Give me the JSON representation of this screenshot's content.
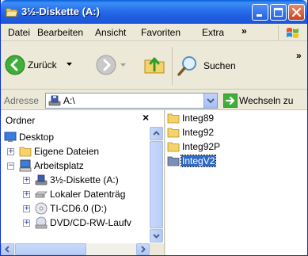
{
  "window": {
    "title": "3½-Diskette (A:)",
    "controls": [
      "minimize",
      "maximize",
      "close"
    ]
  },
  "menubar": {
    "items": [
      "Datei",
      "Bearbeiten",
      "Ansicht",
      "Favoriten",
      "Extra"
    ],
    "overflow": "»"
  },
  "toolbar": {
    "back_label": "Zurück",
    "search_label": "Suchen",
    "overflow": "»"
  },
  "address": {
    "label": "Adresse",
    "value": "A:\\",
    "go_label": "Wechseln zu"
  },
  "folder_pane": {
    "title": "Ordner",
    "close": "×",
    "tree": [
      {
        "label": "Desktop",
        "level": 0,
        "icon": "desktop-icon",
        "expander": ""
      },
      {
        "label": "Eigene Dateien",
        "level": 1,
        "icon": "folder-icon",
        "expander": "+"
      },
      {
        "label": "Arbeitsplatz",
        "level": 1,
        "icon": "computer-icon",
        "expander": "−"
      },
      {
        "label": "3½-Diskette (A:)",
        "level": 2,
        "icon": "floppy-icon",
        "expander": "+"
      },
      {
        "label": "Lokaler Datenträg",
        "level": 2,
        "icon": "harddisk-icon",
        "expander": "+"
      },
      {
        "label": "TI-CD6.0 (D:)",
        "level": 2,
        "icon": "cd-icon",
        "expander": "+"
      },
      {
        "label": "DVD/CD-RW-Laufv",
        "level": 2,
        "icon": "dvd-icon",
        "expander": "+"
      }
    ]
  },
  "file_pane": {
    "items": [
      {
        "label": "Integ89",
        "selected": false
      },
      {
        "label": "Integ92",
        "selected": false
      },
      {
        "label": "Integ92P",
        "selected": false
      },
      {
        "label": "IntegV2",
        "selected": true
      }
    ]
  },
  "colors": {
    "titlebar": "#1e5ee0",
    "selection": "#316ac5",
    "folder": "#f5d36a"
  }
}
